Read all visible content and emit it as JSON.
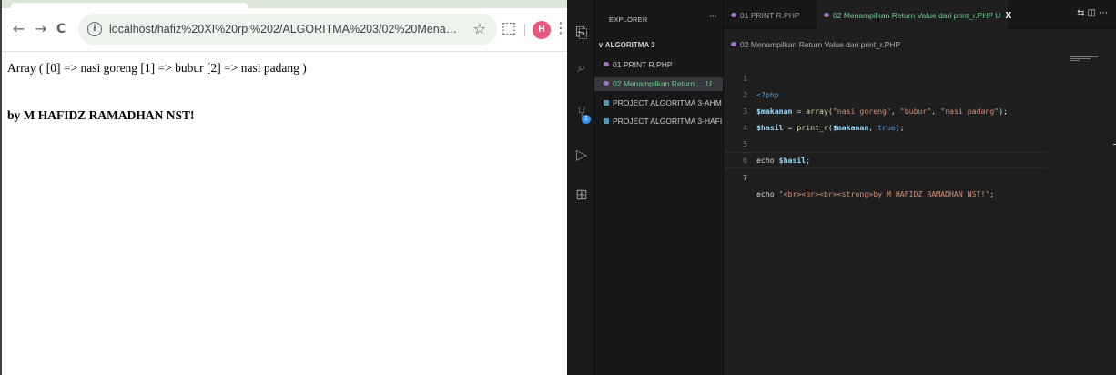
{
  "browser": {
    "url": "localhost/hafiz%20XI%20rpl%202/ALGORITMA%203/02%20Menampilkan%20Return%20Value%20d...",
    "profile_initial": "H",
    "page": {
      "array_output": "Array ( [0] => nasi goreng [1] => bubur [2] => nasi padang )",
      "author_line": "by M HAFIDZ RAMADHAN NST!"
    },
    "icons": {
      "back": "←",
      "forward": "→",
      "reload": "C",
      "info": "i",
      "star": "☆",
      "extensions": "⬚",
      "menu": "⋮"
    }
  },
  "vscode": {
    "explorer": {
      "title": "EXPLORER",
      "more": "···",
      "folder": "ALGORITMA 3",
      "files": [
        {
          "name": "01 PRINT R.PHP",
          "status": ""
        },
        {
          "name": "02 Menampilkan Return ...",
          "status": "U"
        },
        {
          "name": "PROJECT ALGORITMA 3-AHM...",
          "status": ""
        },
        {
          "name": "PROJECT ALGORITMA 3-HAFI...",
          "status": ""
        }
      ]
    },
    "activity_badge": "1",
    "tabs": [
      {
        "label": "01 PRINT R.PHP"
      },
      {
        "label": "02 Menampilkan Return Value dari print_r.PHP",
        "status": "U",
        "close": "X"
      }
    ],
    "breadcrumb": "02 Menampilkan Return Value dari print_r.PHP",
    "line_numbers": [
      "1",
      "2",
      "3",
      "4",
      "5",
      "6",
      "7"
    ],
    "code": {
      "l1_tag": "<?php",
      "l2_var": "$makanan",
      "l2_eq": " = ",
      "l2_fn": "array",
      "l2_open": "(",
      "l2_s1": "\"nasi goreng\"",
      "l2_c1": ", ",
      "l2_s2": "\"bubur\"",
      "l2_c2": ", ",
      "l2_s3": "\"nasi padang\"",
      "l2_close": ");",
      "l3_var": "$hasil",
      "l3_eq": " = ",
      "l3_fn": "print_r",
      "l3_open": "(",
      "l3_arg": "$makanan",
      "l3_comma": ", ",
      "l3_true": "true",
      "l3_close": ");",
      "l5_kw": "echo ",
      "l5_var": "$hasil",
      "l5_semi": ";",
      "l7_kw": "echo ",
      "l7_str": "\"<br><br><br><strong>by M HAFIDZ RAMADHAN NST!\"",
      "l7_semi": ";"
    }
  }
}
